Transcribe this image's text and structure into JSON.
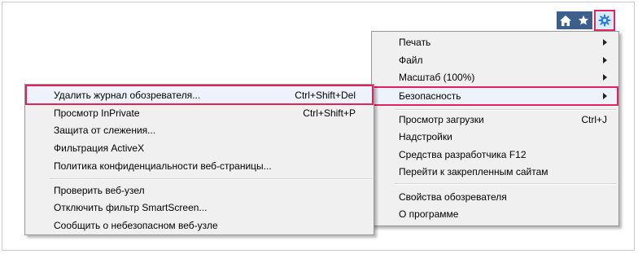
{
  "toolbar": {
    "home_icon": "home-icon",
    "favorites_icon": "star-icon",
    "tools_icon": "gear-icon"
  },
  "main_menu": {
    "items": [
      {
        "label": "Печать",
        "has_submenu": true
      },
      {
        "label": "Файл",
        "has_submenu": true
      },
      {
        "label": "Масштаб (100%)",
        "has_submenu": true
      },
      {
        "label": "Безопасность",
        "has_submenu": true,
        "highlighted": true
      },
      {
        "label": "Просмотр загрузки",
        "shortcut": "Ctrl+J"
      },
      {
        "label": "Надстройки"
      },
      {
        "label": "Средства разработчика F12"
      },
      {
        "label": "Перейти к закрепленным сайтам"
      },
      {
        "label": "Свойства обозревателя"
      },
      {
        "label": "О программе"
      }
    ]
  },
  "security_submenu": {
    "items": [
      {
        "label": "Удалить журнал обозревателя...",
        "shortcut": "Ctrl+Shift+Del",
        "highlighted": true
      },
      {
        "label": "Просмотр InPrivate",
        "shortcut": "Ctrl+Shift+P"
      },
      {
        "label": "Защита от слежения..."
      },
      {
        "label": "Фильтрация ActiveX"
      },
      {
        "label": "Политика конфиденциальности веб-страницы..."
      },
      {
        "label": "Проверить веб-узел"
      },
      {
        "label": "Отключить фильтр SmartScreen..."
      },
      {
        "label": "Сообщить о небезопасном веб-узле"
      }
    ]
  },
  "colors": {
    "highlight_border": "#e0245e",
    "toolbar_button": "#3d5f8c",
    "menu_background": "#f0f0f0"
  }
}
